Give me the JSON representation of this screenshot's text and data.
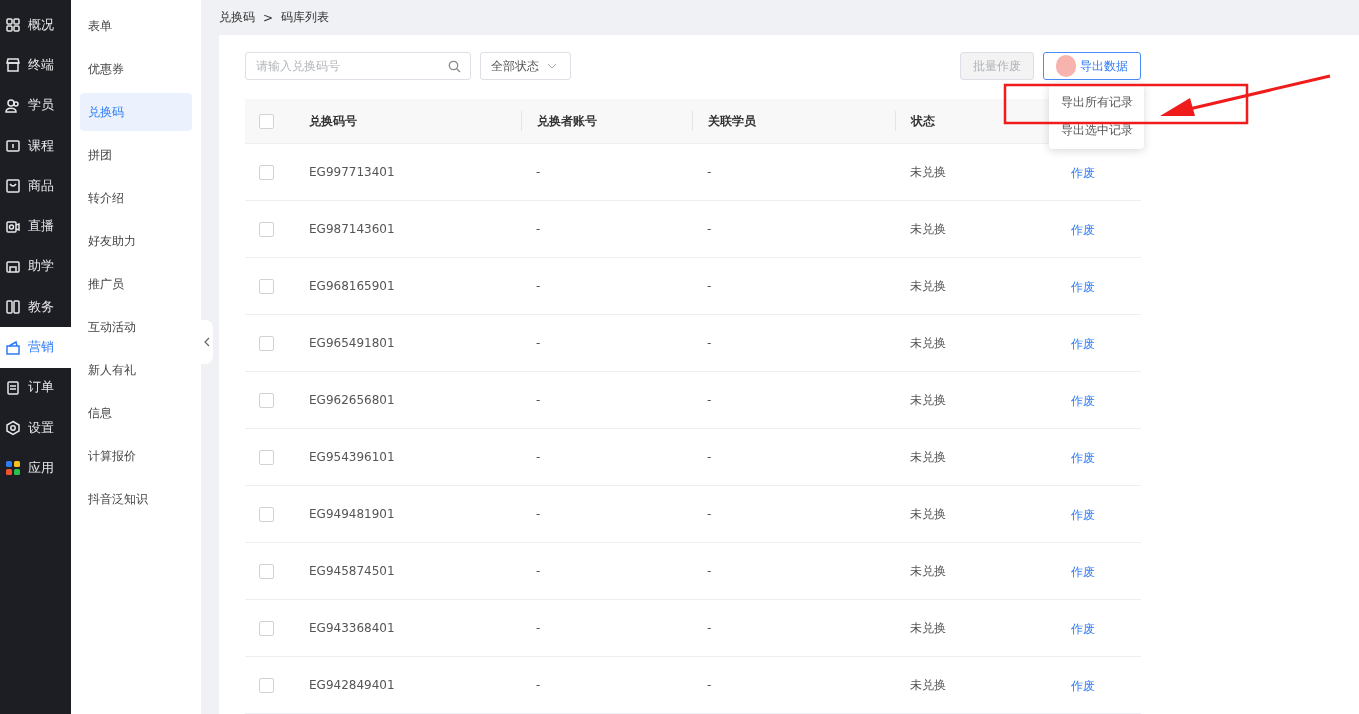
{
  "nav": [
    {
      "label": "概况",
      "selected": false
    },
    {
      "label": "终端",
      "selected": false
    },
    {
      "label": "学员",
      "selected": false
    },
    {
      "label": "课程",
      "selected": false
    },
    {
      "label": "商品",
      "selected": false
    },
    {
      "label": "直播",
      "selected": false
    },
    {
      "label": "助学",
      "selected": false
    },
    {
      "label": "教务",
      "selected": false
    },
    {
      "label": "营销",
      "selected": true
    },
    {
      "label": "订单",
      "selected": false
    },
    {
      "label": "设置",
      "selected": false
    },
    {
      "label": "应用",
      "selected": false
    }
  ],
  "submenu": [
    {
      "label": "表单",
      "selected": false
    },
    {
      "label": "优惠券",
      "selected": false
    },
    {
      "label": "兑换码",
      "selected": true
    },
    {
      "label": "拼团",
      "selected": false
    },
    {
      "label": "转介绍",
      "selected": false
    },
    {
      "label": "好友助力",
      "selected": false
    },
    {
      "label": "推广员",
      "selected": false
    },
    {
      "label": "互动活动",
      "selected": false
    },
    {
      "label": "新人有礼",
      "selected": false
    },
    {
      "label": "信息",
      "selected": false
    },
    {
      "label": "计算报价",
      "selected": false
    },
    {
      "label": "抖音泛知识",
      "selected": false
    }
  ],
  "breadcrumb": [
    "兑换码",
    "码库列表"
  ],
  "breadcrumb_separator": ">",
  "search": {
    "placeholder": "请输入兑换码号"
  },
  "status_filter": "全部状态",
  "batch_button": {
    "label": "批量作废",
    "disabled": true
  },
  "export_button": "导出数据",
  "export_menu": [
    "导出所有记录",
    "导出选中记录"
  ],
  "table": {
    "all_checked": false,
    "columns": [
      "兑换码号",
      "兑换者账号",
      "关联学员",
      "状态"
    ],
    "rows": [
      {
        "code": "EG997713401",
        "account": "-",
        "student": "-",
        "status": "未兑换",
        "action": "作废",
        "checked": false
      },
      {
        "code": "EG987143601",
        "account": "-",
        "student": "-",
        "status": "未兑换",
        "action": "作废",
        "checked": false
      },
      {
        "code": "EG968165901",
        "account": "-",
        "student": "-",
        "status": "未兑换",
        "action": "作废",
        "checked": false
      },
      {
        "code": "EG965491801",
        "account": "-",
        "student": "-",
        "status": "未兑换",
        "action": "作废",
        "checked": false
      },
      {
        "code": "EG962656801",
        "account": "-",
        "student": "-",
        "status": "未兑换",
        "action": "作废",
        "checked": false
      },
      {
        "code": "EG954396101",
        "account": "-",
        "student": "-",
        "status": "未兑换",
        "action": "作废",
        "checked": false
      },
      {
        "code": "EG949481901",
        "account": "-",
        "student": "-",
        "status": "未兑换",
        "action": "作废",
        "checked": false
      },
      {
        "code": "EG945874501",
        "account": "-",
        "student": "-",
        "status": "未兑换",
        "action": "作废",
        "checked": false
      },
      {
        "code": "EG943368401",
        "account": "-",
        "student": "-",
        "status": "未兑换",
        "action": "作废",
        "checked": false
      },
      {
        "code": "EG942849401",
        "account": "-",
        "student": "-",
        "status": "未兑换",
        "action": "作废",
        "checked": false
      }
    ]
  }
}
